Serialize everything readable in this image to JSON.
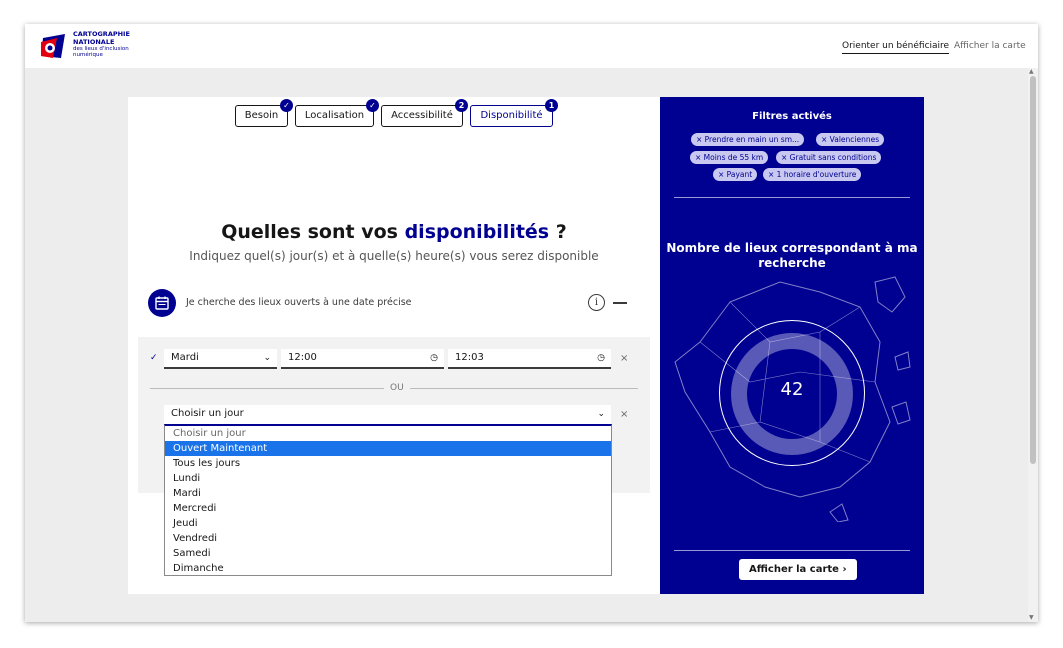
{
  "header": {
    "logo": {
      "line1": "CARTOGRAPHIE",
      "line2": "NATIONALE",
      "line3": "des lieux d'inclusion",
      "line4": "numérique"
    },
    "nav": [
      {
        "label": "Orienter un bénéficiaire"
      },
      {
        "label": "Afficher la carte"
      }
    ]
  },
  "steps": [
    {
      "label": "Besoin",
      "badge": "✓"
    },
    {
      "label": "Localisation",
      "badge": "✓"
    },
    {
      "label": "Accessibilité",
      "badge": "2"
    },
    {
      "label": "Disponibilité",
      "badge": "1"
    }
  ],
  "question": {
    "title_prefix": "Quelles sont vos ",
    "title_highlight": "disponibilités",
    "title_suffix": " ?",
    "subtitle": "Indiquez quel(s) jour(s) et à quelle(s) heure(s) vous serez disponible"
  },
  "date_option": {
    "label": "Je cherche des lieux ouverts à une date précise"
  },
  "schedule": {
    "day": "Mardi",
    "start": "12:00",
    "end": "12:03",
    "separator": "OU",
    "select_placeholder": "Choisir un jour"
  },
  "dropdown_options": [
    "Choisir un jour",
    "Ouvert Maintenant",
    "Tous les jours",
    "Lundi",
    "Mardi",
    "Mercredi",
    "Jeudi",
    "Vendredi",
    "Samedi",
    "Dimanche"
  ],
  "filters": {
    "title": "Filtres activés",
    "tags": [
      "× Prendre en main un sm...",
      "× Valenciennes",
      "× Moins de 55 km",
      "× Gratuit sans conditions",
      "× Payant",
      "× 1 horaire d'ouverture"
    ]
  },
  "results": {
    "title": "Nombre de lieux correspondant à ma recherche",
    "count": "42",
    "show_map": "Afficher la carte ›"
  },
  "colors": {
    "primary": "#000091",
    "highlight": "#1a73e8",
    "tag_bg": "#c8c8f0"
  }
}
